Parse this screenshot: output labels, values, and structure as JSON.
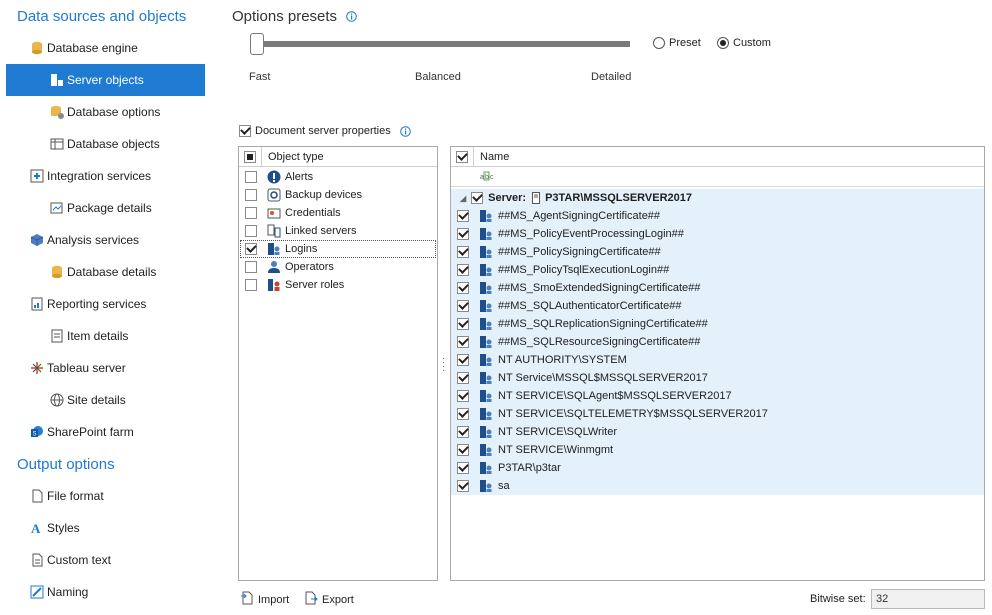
{
  "sidebar": {
    "data_sources_heading": "Data sources and objects",
    "output_heading": "Output options",
    "items": [
      {
        "label": "Database engine",
        "icon": "database-icon"
      },
      {
        "label": "Server objects",
        "icon": "server-objects-icon",
        "active": true
      },
      {
        "label": "Database options",
        "icon": "database-options-icon"
      },
      {
        "label": "Database objects",
        "icon": "table-icon"
      },
      {
        "label": "Integration services",
        "icon": "integration-icon"
      },
      {
        "label": "Package details",
        "icon": "package-icon"
      },
      {
        "label": "Analysis services",
        "icon": "cube-icon"
      },
      {
        "label": "Database details",
        "icon": "database-icon"
      },
      {
        "label": "Reporting services",
        "icon": "report-icon"
      },
      {
        "label": "Item details",
        "icon": "item-icon"
      },
      {
        "label": "Tableau server",
        "icon": "tableau-icon"
      },
      {
        "label": "Site details",
        "icon": "globe-icon"
      },
      {
        "label": "SharePoint farm",
        "icon": "sharepoint-icon"
      }
    ],
    "output_items": [
      {
        "label": "File format",
        "icon": "file-icon"
      },
      {
        "label": "Styles",
        "icon": "styles-icon"
      },
      {
        "label": "Custom text",
        "icon": "text-icon"
      },
      {
        "label": "Naming",
        "icon": "naming-icon"
      }
    ]
  },
  "presets": {
    "title": "Options presets",
    "ticks": [
      "Fast",
      "Balanced",
      "Detailed"
    ],
    "preset_label": "Preset",
    "custom_label": "Custom",
    "selected": "Custom",
    "slider_level": 0
  },
  "doc_props": {
    "label": "Document server properties",
    "checked": true
  },
  "object_pane": {
    "header": "Object type",
    "rows": [
      {
        "label": "Alerts",
        "checked": false,
        "icon": "alert-icon"
      },
      {
        "label": "Backup devices",
        "checked": false,
        "icon": "backup-device-icon"
      },
      {
        "label": "Credentials",
        "checked": false,
        "icon": "credential-icon"
      },
      {
        "label": "Linked servers",
        "checked": false,
        "icon": "linked-server-icon"
      },
      {
        "label": "Logins",
        "checked": true,
        "icon": "login-icon",
        "selected": true
      },
      {
        "label": "Operators",
        "checked": false,
        "icon": "operator-icon"
      },
      {
        "label": "Server roles",
        "checked": false,
        "icon": "server-role-icon"
      }
    ]
  },
  "name_pane": {
    "header": "Name",
    "filter_icon": "abc-filter-icon",
    "server_prefix": "Server:",
    "server_name": "P3TAR\\MSSQLSERVER2017",
    "rows": [
      "##MS_AgentSigningCertificate##",
      "##MS_PolicyEventProcessingLogin##",
      "##MS_PolicySigningCertificate##",
      "##MS_PolicyTsqlExecutionLogin##",
      "##MS_SmoExtendedSigningCertificate##",
      "##MS_SQLAuthenticatorCertificate##",
      "##MS_SQLReplicationSigningCertificate##",
      "##MS_SQLResourceSigningCertificate##",
      "NT AUTHORITY\\SYSTEM",
      "NT Service\\MSSQL$MSSQLSERVER2017",
      "NT SERVICE\\SQLAgent$MSSQLSERVER2017",
      "NT SERVICE\\SQLTELEMETRY$MSSQLSERVER2017",
      "NT SERVICE\\SQLWriter",
      "NT SERVICE\\Winmgmt",
      "P3TAR\\p3tar",
      "sa"
    ]
  },
  "bottom": {
    "import_label": "Import",
    "export_label": "Export",
    "bitwise_label": "Bitwise set:",
    "bitwise_value": "32"
  },
  "colors": {
    "accent": "#1f7ad1",
    "selection_bg": "#e4f0fa"
  }
}
